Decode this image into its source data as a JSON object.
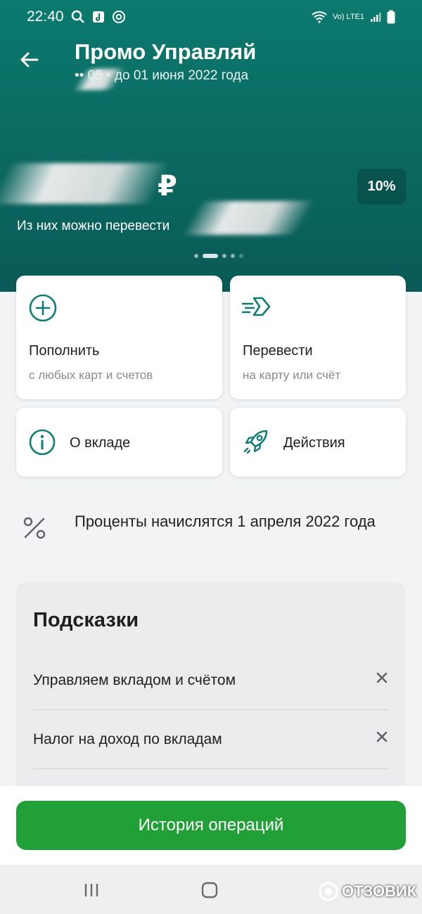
{
  "status_bar": {
    "time": "22:40",
    "network": "Vo) LTE1"
  },
  "header": {
    "title": "Промо Управляй",
    "subtitle": "•• 05   • до 01 июня 2022 года"
  },
  "balance": {
    "currency_sign": "₽",
    "rate_badge": "10%",
    "transfer_note": "Из них можно перевести"
  },
  "actions": {
    "topup": {
      "title": "Пополнить",
      "subtitle": "с любых карт и счетов"
    },
    "transfer": {
      "title": "Перевести",
      "subtitle": "на карту или счёт"
    },
    "about": {
      "title": "О вкладе"
    },
    "more": {
      "title": "Действия"
    }
  },
  "interest": {
    "text": "Проценты начислятся 1 апреля 2022 года"
  },
  "hints": {
    "title": "Подсказки",
    "items": [
      {
        "label": "Управляем вкладом и счётом"
      },
      {
        "label": "Налог на доход по вкладам"
      }
    ]
  },
  "history_button": "История операций",
  "watermark": "ОТЗОВИК",
  "colors": {
    "primary": "#21a038",
    "hero": "#0b6b63",
    "accent": "#0f7c78"
  }
}
